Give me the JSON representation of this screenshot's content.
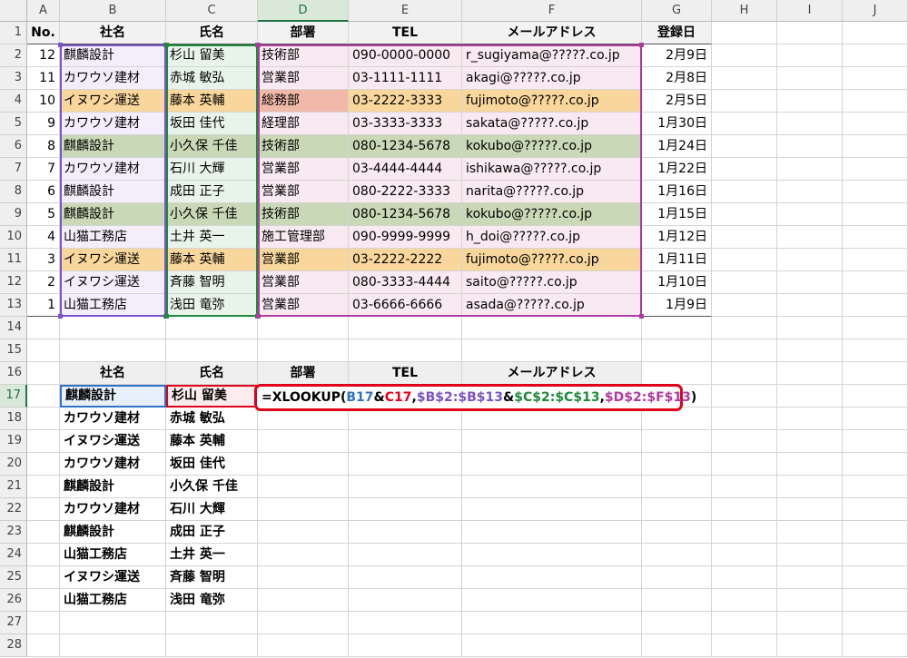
{
  "columns": [
    "A",
    "B",
    "C",
    "D",
    "E",
    "F",
    "G",
    "H",
    "I",
    "J"
  ],
  "rows": [
    1,
    2,
    3,
    4,
    5,
    6,
    7,
    8,
    9,
    10,
    11,
    12,
    13,
    14,
    15,
    16,
    17,
    18,
    19,
    20,
    21,
    22,
    23,
    24,
    25,
    26,
    27,
    28
  ],
  "table_headers": [
    "No.",
    "社名",
    "氏名",
    "部署",
    "TEL",
    "メールアドレス",
    "登録日"
  ],
  "table_rows": [
    [
      "12",
      "麒麟設計",
      "杉山 留美",
      "技術部",
      "090-0000-0000",
      "r_sugiyama@?????.co.jp",
      "2月9日"
    ],
    [
      "11",
      "カワウソ建材",
      "赤城 敏弘",
      "営業部",
      "03-1111-1111",
      "akagi@?????.co.jp",
      "2月8日"
    ],
    [
      "10",
      "イヌワシ運送",
      "藤本 英輔",
      "総務部",
      "03-2222-3333",
      "fujimoto@?????.co.jp",
      "2月5日"
    ],
    [
      "9",
      "カワウソ建材",
      "坂田 佳代",
      "経理部",
      "03-3333-3333",
      "sakata@?????.co.jp",
      "1月30日"
    ],
    [
      "8",
      "麒麟設計",
      "小久保 千佳",
      "技術部",
      "080-1234-5678",
      "kokubo@?????.co.jp",
      "1月24日"
    ],
    [
      "7",
      "カワウソ建材",
      "石川 大輝",
      "営業部",
      "03-4444-4444",
      "ishikawa@?????.co.jp",
      "1月22日"
    ],
    [
      "6",
      "麒麟設計",
      "成田 正子",
      "営業部",
      "080-2222-3333",
      "narita@?????.co.jp",
      "1月16日"
    ],
    [
      "5",
      "麒麟設計",
      "小久保 千佳",
      "技術部",
      "080-1234-5678",
      "kokubo@?????.co.jp",
      "1月15日"
    ],
    [
      "4",
      "山猫工務店",
      "土井 英一",
      "施工管理部",
      "090-9999-9999",
      "h_doi@?????.co.jp",
      "1月12日"
    ],
    [
      "3",
      "イヌワシ運送",
      "藤本 英輔",
      "営業部",
      "03-2222-2222",
      "fujimoto@?????.co.jp",
      "1月11日"
    ],
    [
      "2",
      "イヌワシ運送",
      "斉藤 智明",
      "営業部",
      "080-3333-4444",
      "saito@?????.co.jp",
      "1月10日"
    ],
    [
      "1",
      "山猫工務店",
      "浅田 竜弥",
      "営業部",
      "03-6666-6666",
      "asada@?????.co.jp",
      "1月9日"
    ]
  ],
  "lookup_headers": [
    "社名",
    "氏名",
    "部署",
    "TEL",
    "メールアドレス"
  ],
  "lookup_rows": [
    [
      "麒麟設計",
      "杉山 留美"
    ],
    [
      "カワウソ建材",
      "赤城 敏弘"
    ],
    [
      "イヌワシ運送",
      "藤本 英輔"
    ],
    [
      "カワウソ建材",
      "坂田 佳代"
    ],
    [
      "麒麟設計",
      "小久保 千佳"
    ],
    [
      "カワウソ建材",
      "石川 大輝"
    ],
    [
      "麒麟設計",
      "成田 正子"
    ],
    [
      "山猫工務店",
      "土井 英一"
    ],
    [
      "イヌワシ運送",
      "斉藤 智明"
    ],
    [
      "山猫工務店",
      "浅田 竜弥"
    ]
  ],
  "formula": {
    "eq": "=XLOOKUP(",
    "ref1": "B17",
    "amp1": "&",
    "ref2": "C17",
    "comma1": ",",
    "ref3": "$B$2:$B$13",
    "amp2": "&",
    "ref4": "$C$2:$C$13",
    "comma2": ",",
    "ref5": "$D$2:$F$13",
    "close": ")"
  },
  "colors": {
    "purple_fill": "#f3eefa",
    "green_fill": "#e8f4ea",
    "pink_fill": "#f9eaf2",
    "orange_highlight": "#f9d79c",
    "olive_highlight": "#c9d8b6",
    "salmon_highlight": "#f0b8a8",
    "formula_border": "#e0001a"
  }
}
